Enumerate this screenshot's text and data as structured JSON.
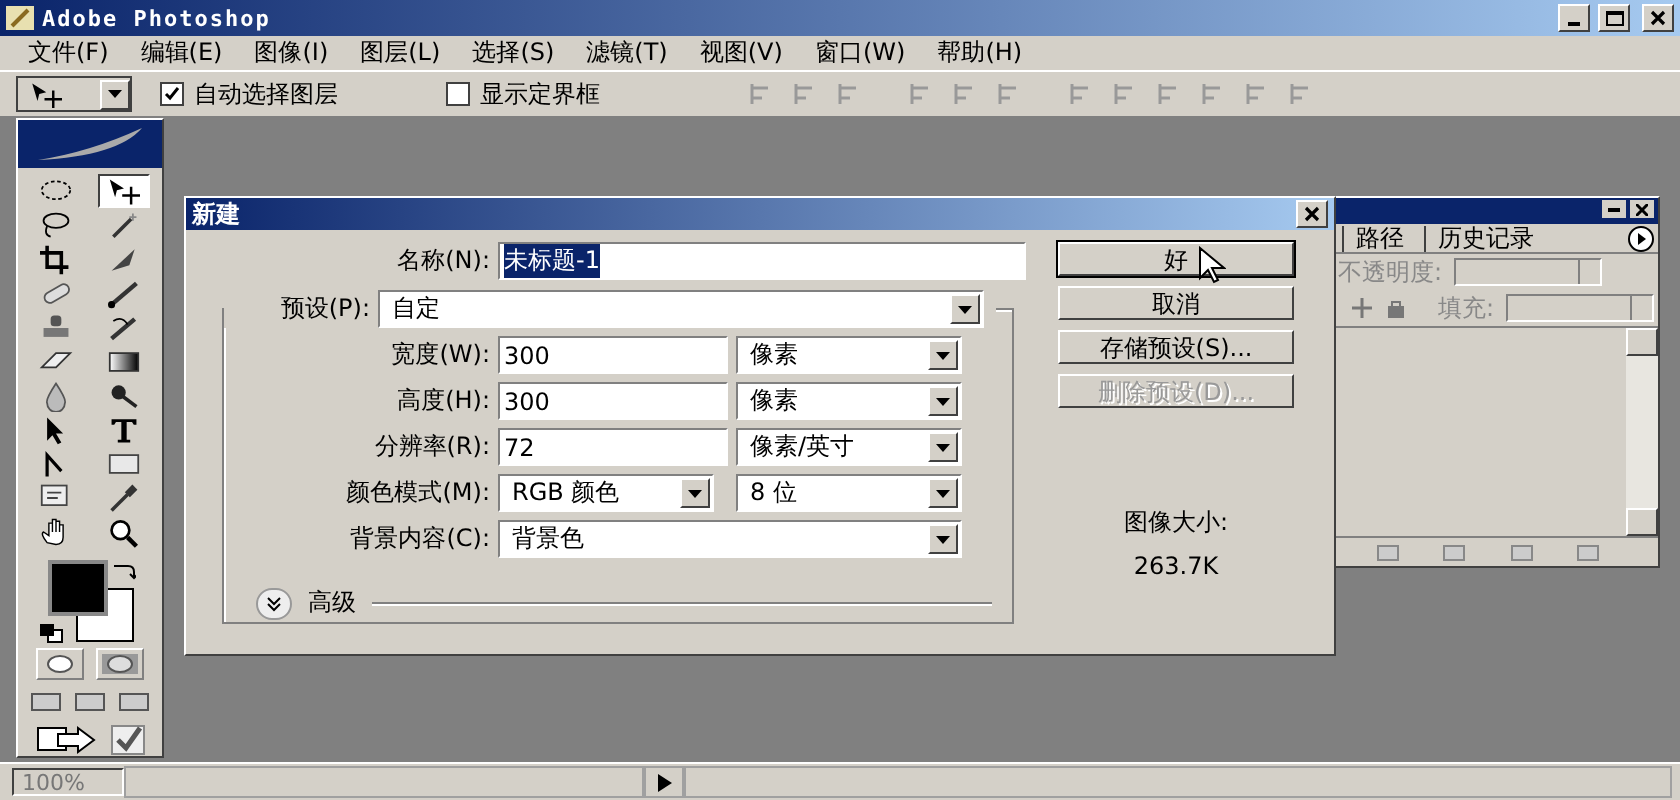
{
  "app": {
    "title": "Adobe Photoshop"
  },
  "menu": [
    "文件(F)",
    "编辑(E)",
    "图像(I)",
    "图层(L)",
    "选择(S)",
    "滤镜(T)",
    "视图(V)",
    "窗口(W)",
    "帮助(H)"
  ],
  "options_bar": {
    "checkboxes": [
      {
        "label": "自动选择图层",
        "checked": true
      },
      {
        "label": "显示定界框",
        "checked": false
      }
    ]
  },
  "tools": [
    {
      "kind": "marquee",
      "selected": false
    },
    {
      "kind": "move",
      "selected": true
    },
    {
      "kind": "lasso",
      "selected": false
    },
    {
      "kind": "wand",
      "selected": false
    },
    {
      "kind": "crop",
      "selected": false
    },
    {
      "kind": "slice",
      "selected": false
    },
    {
      "kind": "heal",
      "selected": false
    },
    {
      "kind": "brush",
      "selected": false
    },
    {
      "kind": "stamp",
      "selected": false
    },
    {
      "kind": "history",
      "selected": false
    },
    {
      "kind": "eraser",
      "selected": false
    },
    {
      "kind": "gradient",
      "selected": false
    },
    {
      "kind": "blur",
      "selected": false
    },
    {
      "kind": "dodge",
      "selected": false
    },
    {
      "kind": "select",
      "selected": false
    },
    {
      "kind": "type",
      "selected": false
    },
    {
      "kind": "pen",
      "selected": false
    },
    {
      "kind": "shape",
      "selected": false
    },
    {
      "kind": "notes",
      "selected": false
    },
    {
      "kind": "eyedropper",
      "selected": false
    },
    {
      "kind": "hand",
      "selected": false
    },
    {
      "kind": "zoom",
      "selected": false
    }
  ],
  "status_bar": {
    "zoom": "100%"
  },
  "dialog": {
    "title": "新建",
    "name": {
      "label": "名称(N):",
      "value": "未标题-1"
    },
    "preset": {
      "label": "预设(P):",
      "value": "自定"
    },
    "rows": [
      {
        "label": "宽度(W):",
        "value": "300",
        "unit": "像素"
      },
      {
        "label": "高度(H):",
        "value": "300",
        "unit": "像素"
      },
      {
        "label": "分辨率(R):",
        "value": "72",
        "unit": "像素/英寸"
      }
    ],
    "color_mode": {
      "label": "颜色模式(M):",
      "value": "RGB 颜色",
      "depth": "8 位"
    },
    "background": {
      "label": "背景内容(C):",
      "value": "背景色"
    },
    "advanced": {
      "label": "高级",
      "expanded": false
    },
    "buttons": [
      {
        "label": "好",
        "disabled": false
      },
      {
        "label": "取消",
        "disabled": false
      },
      {
        "label": "存储预设(S)...",
        "disabled": false
      },
      {
        "label": "删除预设(D)...",
        "disabled": true
      }
    ],
    "image_size": {
      "label": "图像大小:",
      "value": "263.7K"
    }
  },
  "layers_panel": {
    "tabs": [
      {
        "label": "路径",
        "selected": false
      },
      {
        "label": "历史记录",
        "selected": false
      }
    ],
    "opacity_label": "不透明度:",
    "fill_label": "填充:"
  }
}
